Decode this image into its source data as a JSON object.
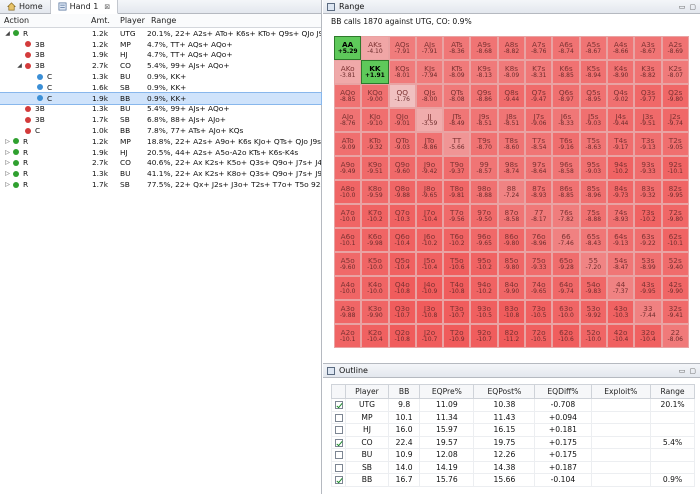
{
  "tabs": [
    {
      "label": "Home",
      "icon": "home-icon"
    },
    {
      "label": "Hand 1",
      "icon": "hand-icon",
      "close": "⊠"
    }
  ],
  "tree_columns": {
    "action": "Action",
    "amt": "Amt.",
    "player": "Player",
    "range": "Range"
  },
  "tree_rows": [
    {
      "indent": 0,
      "exp": "◢",
      "color": "#2fa02f",
      "action": "R",
      "amt": "1.2k",
      "player": "UTG",
      "range": "20.1%, 22+ A2s+ ATo+ K6s+ KTo+ Q9s+ QJo J9s+",
      "sel": false
    },
    {
      "indent": 1,
      "exp": "",
      "color": "#d33b3b",
      "action": "3B",
      "amt": "1.2k",
      "player": "MP",
      "range": "4.7%, TT+ AQs+ AQo+",
      "sel": false
    },
    {
      "indent": 1,
      "exp": "",
      "color": "#d33b3b",
      "action": "3B",
      "amt": "1.9k",
      "player": "HJ",
      "range": "4.7%, TT+ AQs+ AQo+",
      "sel": false
    },
    {
      "indent": 1,
      "exp": "◢",
      "color": "#d33b3b",
      "action": "3B",
      "amt": "2.7k",
      "player": "CO",
      "range": "5.4%, 99+ AJs+ AQo+",
      "sel": false
    },
    {
      "indent": 2,
      "exp": "",
      "color": "#3b8fd6",
      "action": "C",
      "amt": "1.3k",
      "player": "BU",
      "range": "0.9%, KK+",
      "sel": false
    },
    {
      "indent": 2,
      "exp": "",
      "color": "#3b8fd6",
      "action": "C",
      "amt": "1.6k",
      "player": "SB",
      "range": "0.9%, KK+",
      "sel": false
    },
    {
      "indent": 2,
      "exp": "",
      "color": "#3b8fd6",
      "action": "C",
      "amt": "1.9k",
      "player": "BB",
      "range": "0.9%, KK+",
      "sel": true
    },
    {
      "indent": 1,
      "exp": "",
      "color": "#d33b3b",
      "action": "3B",
      "amt": "1.3k",
      "player": "BU",
      "range": "5.4%, 99+ AJs+ AQo+",
      "sel": false
    },
    {
      "indent": 1,
      "exp": "",
      "color": "#d33b3b",
      "action": "3B",
      "amt": "1.7k",
      "player": "SB",
      "range": "6.8%, 88+ AJs+ AJo+",
      "sel": false
    },
    {
      "indent": 1,
      "exp": "",
      "color": "#d33b3b",
      "action": "C",
      "amt": "1.0k",
      "player": "BB",
      "range": "7.8%, 77+ ATs+ AJo+ KQs",
      "sel": false
    },
    {
      "indent": 0,
      "exp": "▷",
      "color": "#2fa02f",
      "action": "R",
      "amt": "1.2k",
      "player": "MP",
      "range": "18.8%, 22+ A2s+ A9o+ K6s KJo+ QTs+ QJo J9s+",
      "sel": false
    },
    {
      "indent": 0,
      "exp": "▷",
      "color": "#2fa02f",
      "action": "R",
      "amt": "1.9k",
      "player": "HJ",
      "range": "20.5%, 44+ A2s+ A5o-A2o KTs+ K6s-K4s",
      "sel": false
    },
    {
      "indent": 0,
      "exp": "▷",
      "color": "#2fa02f",
      "action": "R",
      "amt": "2.7k",
      "player": "CO",
      "range": "40.6%, 22+ Ax K2s+ K5o+ Q3s+ Q9o+ J7s+ J4s",
      "sel": false
    },
    {
      "indent": 0,
      "exp": "▷",
      "color": "#2fa02f",
      "action": "R",
      "amt": "1.3k",
      "player": "BU",
      "range": "41.1%, 22+ Ax K2s+ K8o+ Q3s+ Q9o+ J7s+ J9o+",
      "sel": false
    },
    {
      "indent": 0,
      "exp": "▷",
      "color": "#2fa02f",
      "action": "R",
      "amt": "1.7k",
      "player": "SB",
      "range": "77.5%, 22+ Qx+ J2s+ J3o+ T2s+ T7o+ T5o 92s+",
      "sel": false
    }
  ],
  "range_panel": {
    "title": "Range",
    "subtitle": "BB calls 1870 against UTG, CO: 0.9%",
    "cells": [
      [
        "AA|+5.29",
        "AKs|-4.10",
        "AQs|-7.91",
        "AJs|-7.91",
        "ATs|-8.36",
        "A9s|-8.68",
        "A8s|-8.82",
        "A7s|-8.76",
        "A6s|-8.74",
        "A5s|-8.67",
        "A4s|-8.66",
        "A3s|-8.67",
        "A2s|-8.69"
      ],
      [
        "AKo|-3.81",
        "KK|+1.91",
        "KQs|-8.01",
        "KJs|-7.94",
        "KTs|-8.09",
        "K9s|-8.13",
        "K8s|-8.09",
        "K7s|-8.31",
        "K6s|-8.85",
        "K5s|-8.94",
        "K4s|-8.90",
        "K3s|-8.82",
        "K2s|-8.07"
      ],
      [
        "AQo|-8.85",
        "KQo|-9.00",
        "QQ|-1.76",
        "QJs|-8.00",
        "QTs|-8.08",
        "Q9s|-8.86",
        "Q8s|-9.44",
        "Q7s|-9.47",
        "Q6s|-8.97",
        "Q5s|-8.95",
        "Q4s|-9.02",
        "Q3s|-9.77",
        "Q2s|-9.80"
      ],
      [
        "AJo|-8.76",
        "KJo|-9.10",
        "QJo|-9.01",
        "JJ|-3.59",
        "JTs|-8.49",
        "J9s|-8.51",
        "J8s|-8.51",
        "J7s|-9.06",
        "J6s|-8.33",
        "J5s|-9.03",
        "J4s|-9.44",
        "J3s|-9.51",
        "J2s|-9.74"
      ],
      [
        "ATo|-9.09",
        "KTo|-9.32",
        "QTo|-9.03",
        "JTo|-8.86",
        "TT|-5.66",
        "T9s|-8.70",
        "T8s|-8.60",
        "T7s|-8.54",
        "T6s|-9.16",
        "T5s|-8.63",
        "T4s|-9.17",
        "T3s|-9.13",
        "T2s|-9.05"
      ],
      [
        "A9o|-9.49",
        "K9o|-9.51",
        "Q9o|-9.60",
        "J9o|-9.42",
        "T9o|-9.37",
        "99|-8.57",
        "98s|-8.74",
        "97s|-8.64",
        "96s|-8.58",
        "95s|-9.03",
        "94s|-10.2",
        "93s|-9.33",
        "92s|-10.1"
      ],
      [
        "A8o|-10.0",
        "K8o|-9.59",
        "Q8o|-9.88",
        "J8o|-9.65",
        "T8o|-9.81",
        "98o|-8.88",
        "88|-7.24",
        "87s|-8.93",
        "86s|-8.85",
        "85s|-8.96",
        "84s|-9.73",
        "83s|-9.32",
        "82s|-9.95"
      ],
      [
        "A7o|-10.0",
        "K7o|-10.2",
        "Q7o|-10.3",
        "J7o|-10.4",
        "T7o|-9.56",
        "97o|-9.50",
        "87o|-8.58",
        "77|-8.17",
        "76s|-7.82",
        "75s|-8.88",
        "74s|-8.93",
        "73s|-10.2",
        "72s|-9.80"
      ],
      [
        "A6o|-10.1",
        "K6o|-9.98",
        "Q6o|-10.4",
        "J6o|-10.2",
        "T6o|-10.2",
        "96o|-9.65",
        "86o|-9.80",
        "76o|-8.96",
        "66|-7.46",
        "65s|-8.43",
        "64s|-9.13",
        "63s|-9.22",
        "62s|-10.1"
      ],
      [
        "A5o|-9.60",
        "K5o|-10.0",
        "Q5o|-10.4",
        "J5o|-10.4",
        "T5o|-10.6",
        "95o|-10.2",
        "85o|-9.80",
        "75o|-9.33",
        "65o|-9.28",
        "55|-7.20",
        "54s|-8.47",
        "53s|-8.99",
        "52s|-9.40"
      ],
      [
        "A4o|-10.0",
        "K4o|-10.0",
        "Q4o|-10.8",
        "J4o|-10.9",
        "T4o|-10.8",
        "94o|-10.2",
        "84o|-9.90",
        "74o|-9.65",
        "64o|-9.74",
        "54o|-9.83",
        "44|-7.37",
        "43s|-9.95",
        "42s|-9.90"
      ],
      [
        "A3o|-9.88",
        "K3o|-9.90",
        "Q3o|-10.7",
        "J3o|-10.8",
        "T3o|-10.7",
        "93o|-10.5",
        "83o|-10.8",
        "73o|-10.5",
        "63o|-10.0",
        "53o|-9.92",
        "43o|-10.3",
        "33|-7.44",
        "32s|-9.41"
      ],
      [
        "A2o|-10.1",
        "K2o|-10.4",
        "Q2o|-10.8",
        "J2o|-10.7",
        "T2o|-10.9",
        "92o|-10.7",
        "82o|-11.2",
        "72o|-10.5",
        "62o|-10.6",
        "52o|-10.0",
        "42o|-10.4",
        "32o|-10.4",
        "22|-8.06"
      ]
    ],
    "highlighted": [
      "AA",
      "KK"
    ],
    "in_range_color": "#5ec95a",
    "out_range_color": "#f08c8c"
  },
  "outline_panel": {
    "title": "Outline",
    "columns": [
      "Player",
      "BB",
      "EQPre%",
      "EQPost%",
      "EQDiff%",
      "Exploit%",
      "Range"
    ],
    "rows": [
      {
        "checked": true,
        "player": "UTG",
        "bb": "9.8",
        "eqpre": "11.09",
        "eqpost": "10.38",
        "eqdiff": "-0.708",
        "exploit": "",
        "range": "20.1%"
      },
      {
        "checked": false,
        "player": "MP",
        "bb": "10.1",
        "eqpre": "11.34",
        "eqpost": "11.43",
        "eqdiff": "+0.094",
        "exploit": "",
        "range": ""
      },
      {
        "checked": false,
        "player": "HJ",
        "bb": "16.0",
        "eqpre": "15.97",
        "eqpost": "16.15",
        "eqdiff": "+0.181",
        "exploit": "",
        "range": ""
      },
      {
        "checked": true,
        "player": "CO",
        "bb": "22.4",
        "eqpre": "19.57",
        "eqpost": "19.75",
        "eqdiff": "+0.175",
        "exploit": "",
        "range": "5.4%"
      },
      {
        "checked": false,
        "player": "BU",
        "bb": "10.9",
        "eqpre": "12.08",
        "eqpost": "12.26",
        "eqdiff": "+0.175",
        "exploit": "",
        "range": ""
      },
      {
        "checked": false,
        "player": "SB",
        "bb": "14.0",
        "eqpre": "14.19",
        "eqpost": "14.38",
        "eqdiff": "+0.187",
        "exploit": "",
        "range": ""
      },
      {
        "checked": true,
        "player": "BB",
        "bb": "16.7",
        "eqpre": "15.76",
        "eqpost": "15.66",
        "eqdiff": "-0.104",
        "exploit": "",
        "range": "0.9%"
      }
    ]
  }
}
